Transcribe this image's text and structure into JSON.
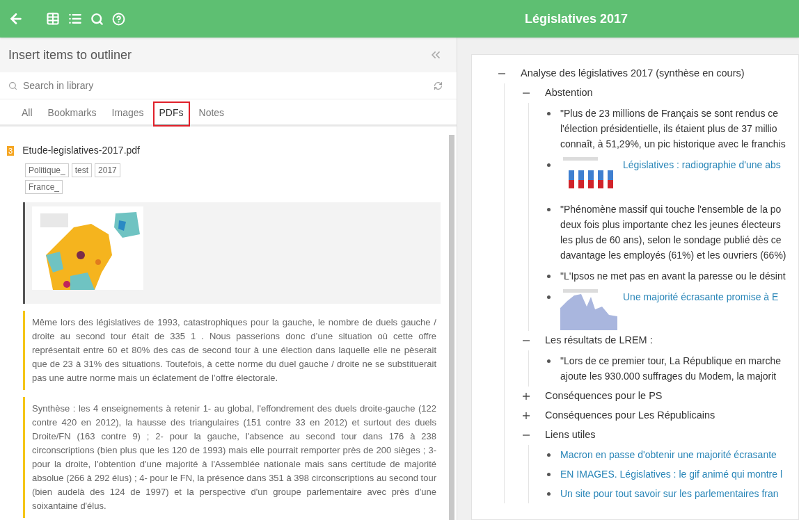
{
  "header": {
    "title": "Législatives 2017"
  },
  "library": {
    "title": "Insert items to outliner",
    "search": {
      "placeholder": "Search in library"
    },
    "tabs": [
      {
        "label": "All",
        "selected": false
      },
      {
        "label": "Bookmarks",
        "selected": false
      },
      {
        "label": "Images",
        "selected": false
      },
      {
        "label": "PDFs",
        "selected": true
      },
      {
        "label": "Notes",
        "selected": false
      }
    ],
    "document": {
      "count": "3",
      "title": "Etude-legislatives-2017.pdf",
      "tags": [
        "Politique_",
        "test",
        "2017",
        "France_"
      ],
      "clips": [
        {
          "kind": "picture"
        },
        {
          "kind": "quote",
          "text": "Même lors des législatives de 1993, catastrophiques pour la gauche, le nombre de duels gauche / droite au second tour était de 335 1 . Nous passerions donc d’une situation où cette offre représentait entre 60 et 80% des cas de second tour à une élection dans laquelle elle ne pèserait que de 23 à 31% des situations. Toutefois, à cette norme du duel gauche / droite ne se substituerait pas une autre norme mais un éclatement de l’offre électorale."
        },
        {
          "kind": "quote",
          "text": "Synthèse : les 4 enseignements à retenir 1- au global, l'effondrement des duels droite-gauche (122 contre 420 en 2012), la hausse des triangulaires (151 contre 33 en 2012) et surtout des duels Droite/FN (163 contre 9) ; 2- pour la gauche, l'absence au second tour dans 176 à 238 circonscriptions (bien plus que les 120 de 1993) mais elle pourrait remporter près de 200 sièges ; 3- pour la droite, l'obtention d'une majorité à l'Assemblée nationale mais sans certitude de majorité absolue (266 à 292 élus) ; 4- pour le FN, la présence dans 351 à 398 circonscriptions au second tour (bien audelà des 124 de 1997) et la perspective d'un groupe parlementaire avec près d'une soixantaine d'élus."
        }
      ]
    }
  },
  "outline": [
    {
      "kind": "heading",
      "text": "Analyse des législatives 2017 (synthèse en cours)",
      "expanded": true,
      "children": [
        {
          "kind": "heading",
          "text": "Abstention",
          "expanded": true,
          "children": [
            {
              "kind": "text",
              "lines": [
                "\"Plus de 23 millions de Français se sont rendus ce",
                "l'élection présidentielle, ils étaient plus de 37 millio",
                "connaît, à 51,29%, un pic historique avec le franchis"
              ]
            },
            {
              "kind": "image_link",
              "text": "Législatives : radiographie d'une abs"
            },
            {
              "kind": "text",
              "lines": [
                "\"Phénomène massif qui touche l'ensemble de la po",
                "deux fois plus importante chez les jeunes électeurs",
                "les plus de 60 ans), selon le sondage publié dès ce",
                "davantage les employés (61%) et les ouvriers (66%)"
              ]
            },
            {
              "kind": "text",
              "lines": [
                "\"L'Ipsos ne met pas en avant la paresse ou le désint"
              ]
            },
            {
              "kind": "image_link",
              "text": "Une majorité écrasante promise à E"
            }
          ]
        },
        {
          "kind": "heading",
          "text": "Les résultats de LREM :",
          "expanded": true,
          "children": [
            {
              "kind": "text",
              "lines": [
                "\"Lors de ce premier tour, La République en marche",
                "ajoute les 930.000 suffrages du Modem, la majorit"
              ]
            }
          ]
        },
        {
          "kind": "heading",
          "text": "Conséquences pour le PS",
          "expanded": false
        },
        {
          "kind": "heading",
          "text": "Conséquences pour Les Républicains",
          "expanded": false
        },
        {
          "kind": "heading",
          "text": "Liens utiles",
          "expanded": true,
          "children": [
            {
              "kind": "link",
              "text": "Macron en passe d'obtenir une majorité écrasante"
            },
            {
              "kind": "link",
              "text": "EN IMAGES. Législatives : le gif animé qui montre l"
            },
            {
              "kind": "link",
              "text": "Un site pour tout savoir sur les parlementaires fran"
            }
          ]
        }
      ]
    }
  ]
}
